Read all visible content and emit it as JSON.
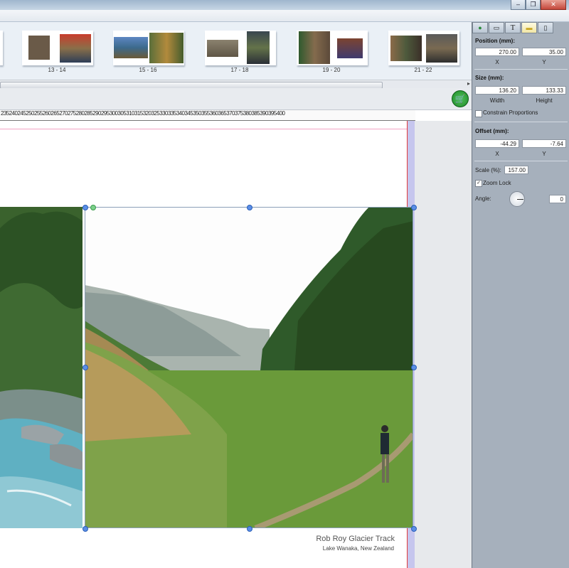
{
  "window": {
    "minimize": "–",
    "maximize": "❐",
    "close": "✕"
  },
  "spreads": [
    {
      "label": "13 - 14"
    },
    {
      "label": "15 - 16"
    },
    {
      "label": "17 - 18"
    },
    {
      "label": "19 - 20"
    },
    {
      "label": "21 - 22"
    }
  ],
  "ruler": {
    "ticks": [
      "235",
      "240",
      "245",
      "250",
      "255",
      "260",
      "265",
      "270",
      "275",
      "280",
      "285",
      "290",
      "295",
      "300",
      "305",
      "310",
      "315",
      "320",
      "325",
      "330",
      "335",
      "340",
      "345",
      "350",
      "355",
      "360",
      "365",
      "370",
      "375",
      "380",
      "385",
      "390",
      "395",
      "400"
    ]
  },
  "toolbar": {
    "cart_icon": "shopping-cart-icon",
    "cart_glyph": "🛒"
  },
  "caption": {
    "title": "Rob Roy Glacier Track",
    "subtitle": "Lake Wanaka, New Zealand"
  },
  "props": {
    "tabs": [
      "●",
      "▭",
      "T",
      "▬",
      "▯"
    ],
    "position_title": "Position (mm):",
    "pos_x": "270.00",
    "pos_y": "35.00",
    "x_label": "X",
    "y_label": "Y",
    "size_title": "Size (mm):",
    "width": "136.20",
    "height": "133.33",
    "width_label": "Width",
    "height_label": "Height",
    "constrain_label": "Constrain Proportions",
    "offset_title": "Offset (mm):",
    "off_x": "-44.29",
    "off_y": "-7.64",
    "scale_label": "Scale (%):",
    "scale": "157.00",
    "zoom_lock_label": "Zoom Lock",
    "zoom_lock_check": "✓",
    "angle_label": "Angle:",
    "angle": "0"
  }
}
